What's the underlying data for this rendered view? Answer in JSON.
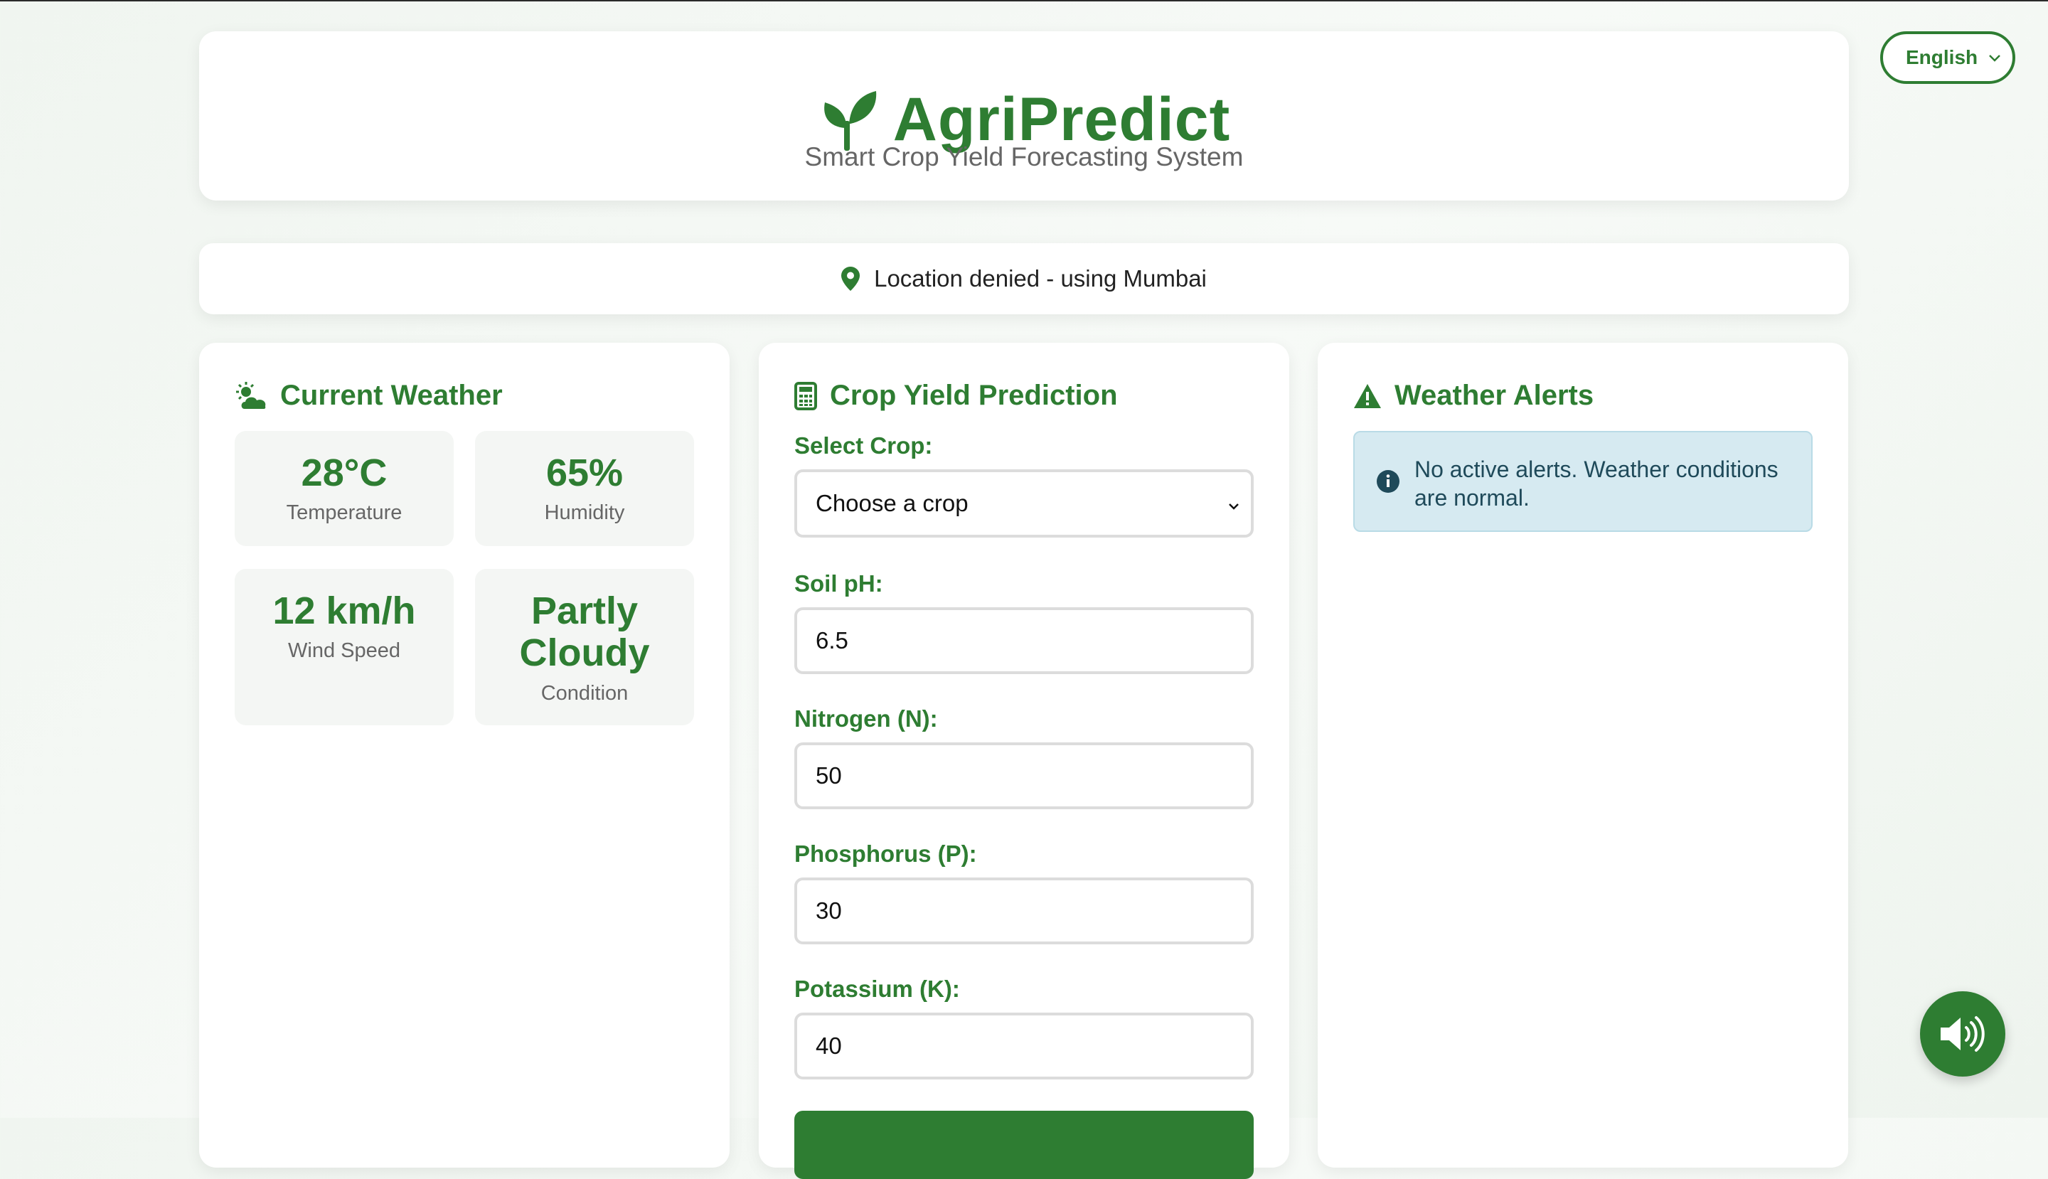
{
  "header": {
    "title": "AgriPredict",
    "subtitle": "Smart Crop Yield Forecasting System"
  },
  "language": {
    "selected": "English"
  },
  "location": {
    "text": "Location denied - using Mumbai"
  },
  "weather": {
    "title": "Current Weather",
    "tiles": [
      {
        "value": "28°C",
        "label": "Temperature"
      },
      {
        "value": "65%",
        "label": "Humidity"
      },
      {
        "value": "12 km/h",
        "label": "Wind Speed"
      },
      {
        "value": "Partly Cloudy",
        "label": "Condition"
      }
    ]
  },
  "prediction": {
    "title": "Crop Yield Prediction",
    "crop_label": "Select Crop:",
    "crop_value": "Choose a crop",
    "ph_label": "Soil pH:",
    "ph_value": "6.5",
    "n_label": "Nitrogen (N):",
    "n_value": "50",
    "p_label": "Phosphorus (P):",
    "p_value": "30",
    "k_label": "Potassium (K):",
    "k_value": "40"
  },
  "alerts": {
    "title": "Weather Alerts",
    "message": "No active alerts. Weather conditions are normal."
  },
  "colors": {
    "primary": "#2e7d32",
    "alert_bg": "#d6eaf1",
    "alert_text": "#1f4a5a"
  },
  "icons": [
    "seedling-icon",
    "chevron-down-icon",
    "map-pin-icon",
    "cloud-sun-icon",
    "calculator-icon",
    "warning-icon",
    "info-icon",
    "speaker-icon"
  ]
}
